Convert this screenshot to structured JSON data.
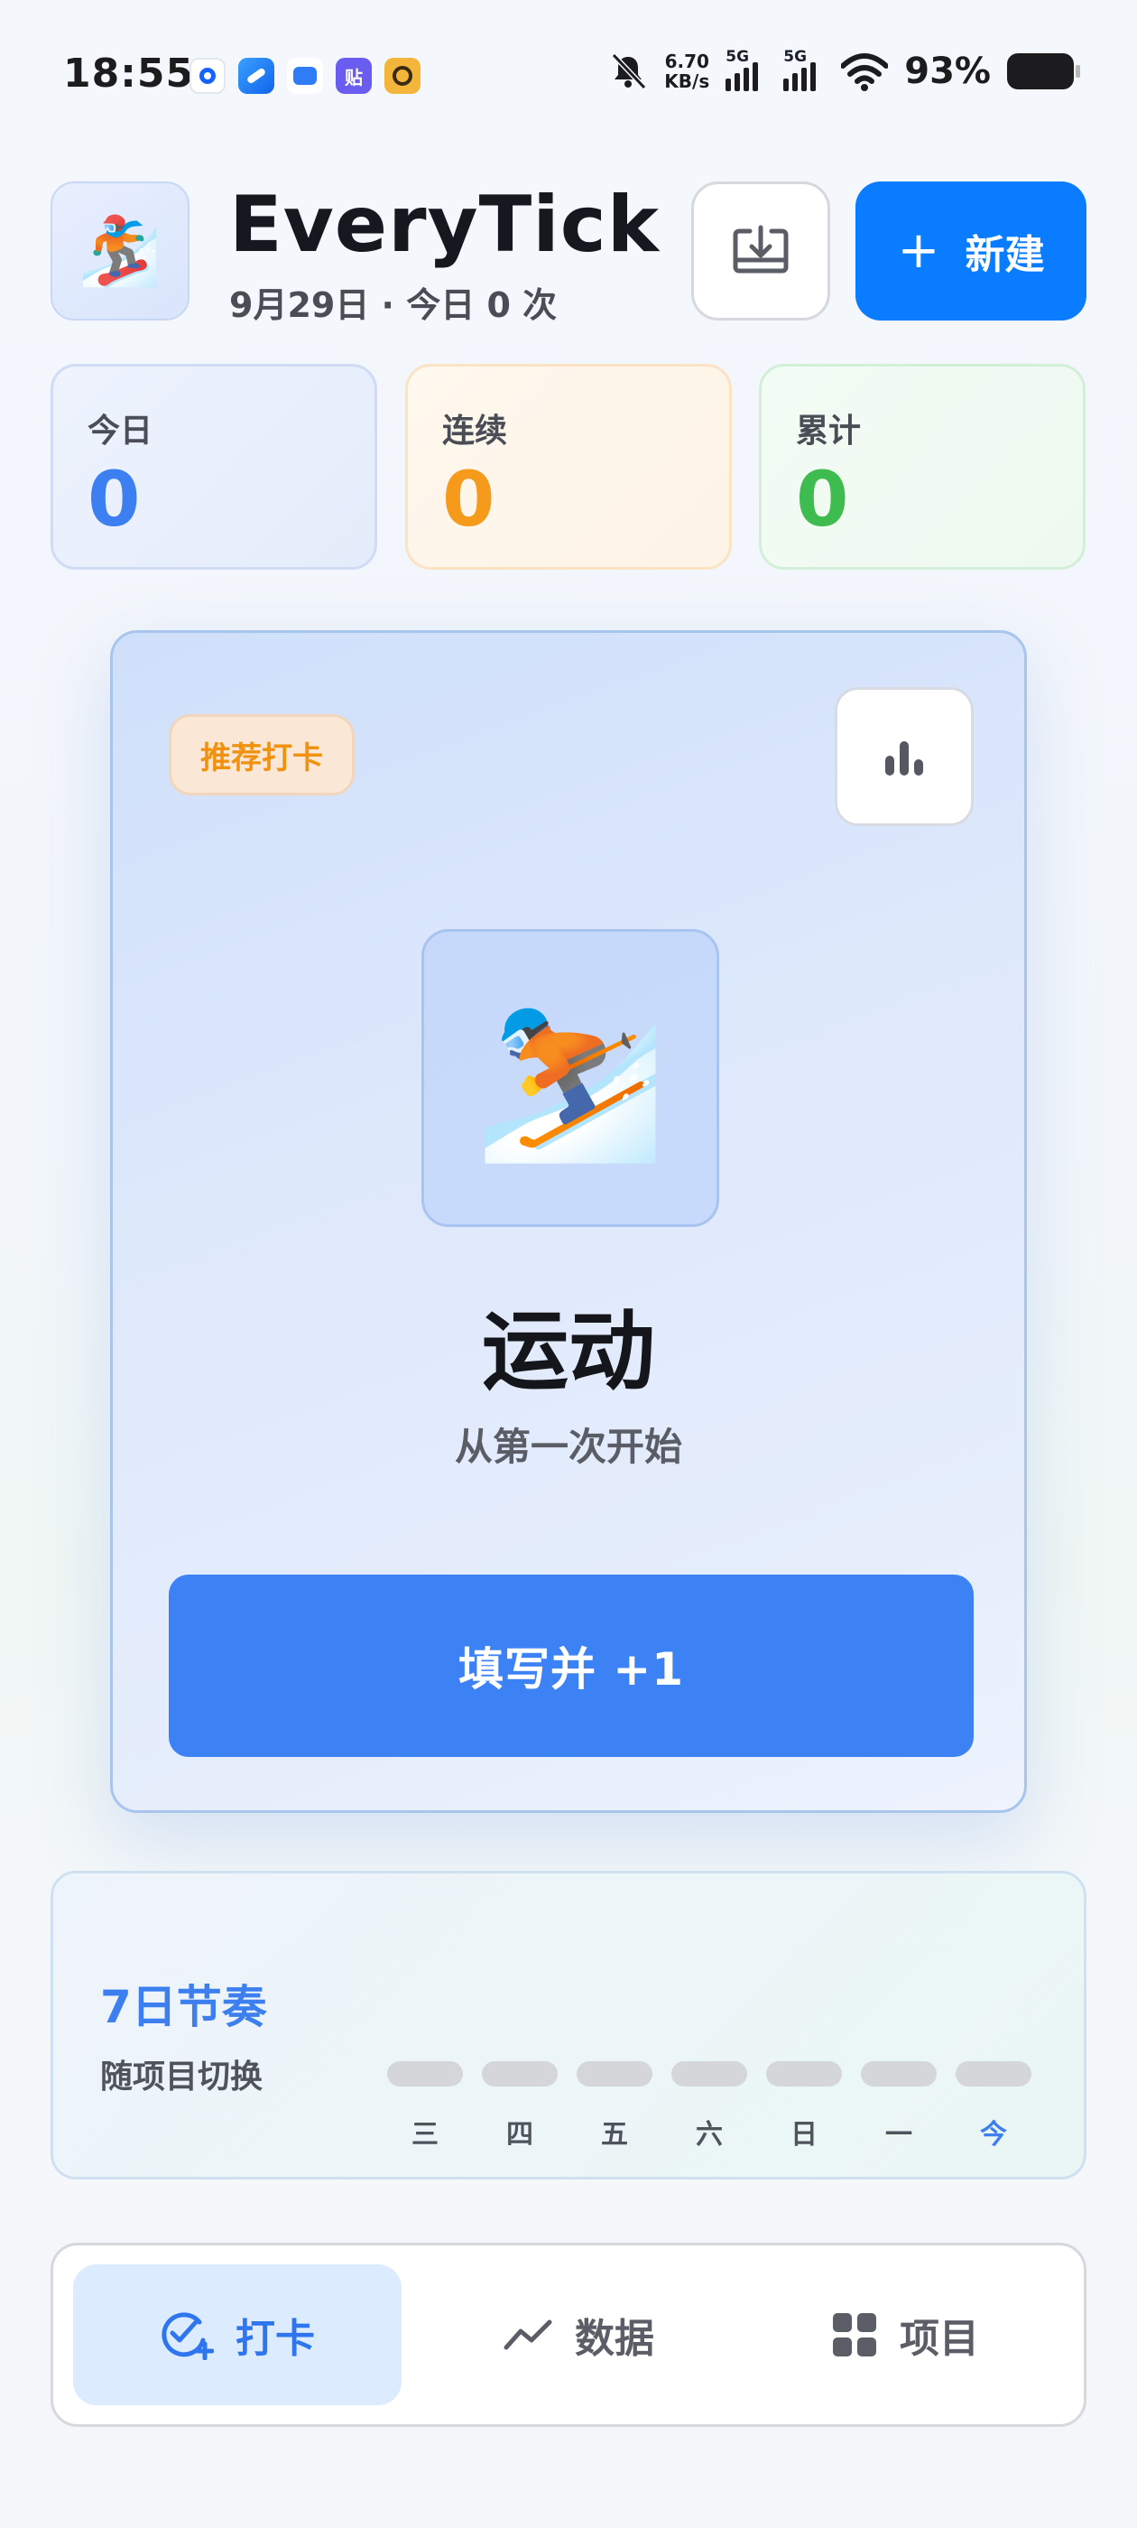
{
  "status_bar": {
    "time": "18:55",
    "speed_value": "6.70",
    "speed_unit": "KB/s",
    "net1": "5G",
    "net2": "5G",
    "battery": "93%",
    "app_badge_text": "贴"
  },
  "header": {
    "app_icon": "🏂",
    "title": "EveryTick",
    "subtitle": "9月29日 · 今日 0 次",
    "new_button": "新建"
  },
  "stats": {
    "today_label": "今日",
    "today_value": "0",
    "streak_label": "连续",
    "streak_value": "0",
    "total_label": "累计",
    "total_value": "0"
  },
  "card": {
    "badge": "推荐打卡",
    "project_emoji": "⛷️",
    "project_name": "运动",
    "project_hint": "从第一次开始",
    "action_button": "填写并 +1"
  },
  "rhythm": {
    "title": "7日节奏",
    "subtitle": "随项目切换",
    "days": [
      "三",
      "四",
      "五",
      "六",
      "日",
      "一",
      "今"
    ]
  },
  "nav": {
    "checkin": "打卡",
    "data": "数据",
    "projects": "项目"
  },
  "colors": {
    "primary": "#0a7cff",
    "today_blue": "#3b7ff0",
    "streak_orange": "#f59a1b",
    "total_green": "#3ebc4f"
  }
}
